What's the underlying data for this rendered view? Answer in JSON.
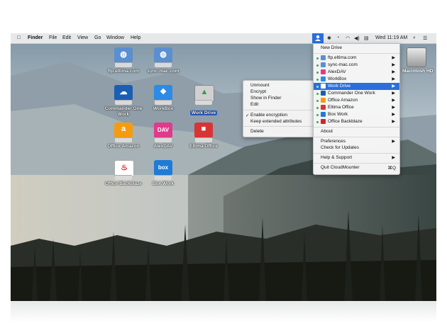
{
  "menubar": {
    "apple": "",
    "items": [
      "Finder",
      "File",
      "Edit",
      "View",
      "Go",
      "Window",
      "Help"
    ],
    "clock": "Wed 11:19 AM"
  },
  "desktop": {
    "icons": [
      {
        "label": "ftp.eltima.com",
        "icon": "globe-drive-icon",
        "color": "#5a8fd0",
        "glyph": "🌐"
      },
      {
        "label": "sync-mac.com",
        "icon": "globe-drive-icon",
        "color": "#5a8fd0",
        "glyph": "🌐"
      },
      {
        "label": "Commander One Work",
        "icon": "onedrive-icon",
        "color": "#1a5fb4",
        "glyph": "☁"
      },
      {
        "label": "WorkBox",
        "icon": "dropbox-icon",
        "color": "#2b8be6",
        "glyph": "❖"
      },
      {
        "label": "Work Drive",
        "icon": "google-drive-icon",
        "color": "#7b7b7b",
        "glyph": "▲"
      },
      {
        "label": "Office Amazon",
        "icon": "amazon-icon",
        "color": "#f39c12",
        "glyph": "a"
      },
      {
        "label": "AlexDAV",
        "icon": "webdav-icon",
        "color": "#e03a8c",
        "glyph": "DAV"
      },
      {
        "label": "Eltima Office",
        "icon": "eltima-icon",
        "color": "#d93434",
        "glyph": "■"
      },
      {
        "label": "Office Backblaze",
        "icon": "backblaze-icon",
        "color": "#e02020",
        "glyph": "🔥"
      },
      {
        "label": "Box Work",
        "icon": "box-icon",
        "color": "#1e7bd6",
        "glyph": "box"
      }
    ],
    "hd_label": "Macintosh HD"
  },
  "context_menu": {
    "items": [
      "Unmount",
      "Encrypt",
      "Show in Finder",
      "Edit"
    ],
    "check_items": [
      "Enable encryption",
      "Keep extended attributes"
    ],
    "checked": "Enable encryption",
    "delete": "Delete"
  },
  "cloudmounter": {
    "new_drive": "New Drive",
    "drives": [
      {
        "label": "ftp.eltima.com",
        "color": "#5a8fd0"
      },
      {
        "label": "sync-mac.com",
        "color": "#5a8fd0"
      },
      {
        "label": "AlexDAV",
        "color": "#e03a8c"
      },
      {
        "label": "WorkBox",
        "color": "#2b8be6"
      },
      {
        "label": "Work Drive",
        "color": "#7b7b7b"
      },
      {
        "label": "Commander One Work",
        "color": "#1a5fb4"
      },
      {
        "label": "Office Amazon",
        "color": "#f39c12"
      },
      {
        "label": "Eltima Office",
        "color": "#d93434"
      },
      {
        "label": "Box Work",
        "color": "#1e7bd6"
      },
      {
        "label": "Office Backblaze",
        "color": "#e02020"
      }
    ],
    "highlighted": "Work Drive",
    "about": "About",
    "preferences": "Preferences",
    "check_updates": "Check for Updates",
    "help": "Help & Support",
    "quit": "Quit CloudMounter",
    "quit_shortcut": "⌘Q"
  }
}
